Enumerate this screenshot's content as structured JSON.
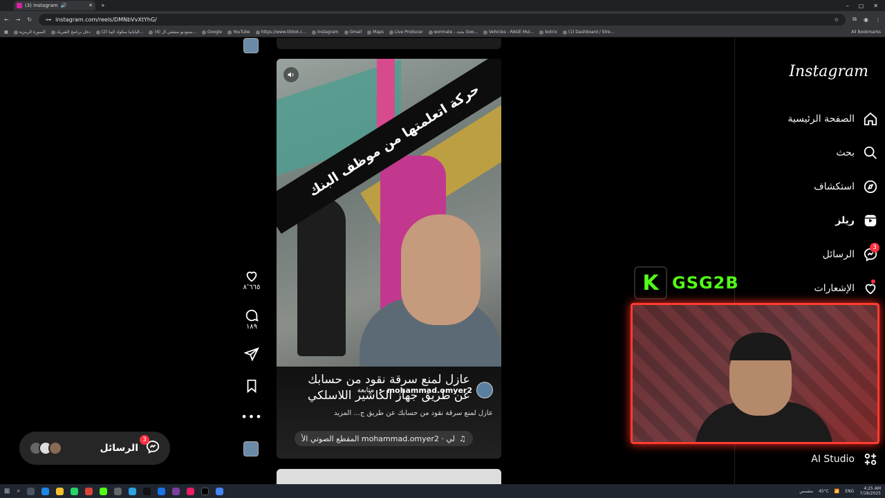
{
  "browser": {
    "tab_title": "(3) Instagram",
    "url": "instagram.com/reels/DMNbVvXtYhG/",
    "bookmarks": [
      "الصورة الرمزية",
      "دخل برنامج الشريك",
      "(2) اليابانيا سكواد اليبا...",
      "(4) ستوديو منشئي ال...",
      "Google",
      "YouTube",
      "https://www.tiktok.c...",
      "Instagram",
      "Gmail",
      "Maps",
      "Live Producer",
      "wormate - بحث Goo...",
      "Vehicles - RAGE Mul...",
      "botrix",
      "(1) Dashboard / Stre..."
    ],
    "all_bookmarks": "All Bookmarks"
  },
  "sidebar": {
    "logo": "Instagram",
    "items": [
      {
        "label": "الصفحة الرئيسية",
        "icon": "home-icon"
      },
      {
        "label": "بحث",
        "icon": "search-icon"
      },
      {
        "label": "استكشاف",
        "icon": "compass-icon"
      },
      {
        "label": "ريلز",
        "icon": "reels-icon"
      },
      {
        "label": "الرسائل",
        "icon": "messenger-icon",
        "badge": "3"
      },
      {
        "label": "الإشعارات",
        "icon": "heart-icon"
      }
    ],
    "ai_studio": "AI Studio"
  },
  "reel": {
    "banner_text": "حركة اتعلمتها من موظف البنك",
    "caption_big_line1": "عازل لمنع سرقة نقود من حسابك",
    "caption_big_line2": "عن طريق جهاز الكاشير اللاسلكي",
    "author": "mohammad.omyer2",
    "follow": "متابعة",
    "caption_small": "عازل لمنع سرقة نقود من حسابك عن طريق ج... المزيد",
    "audio": "لي · mohammad.omyer2 المقطع الصوتي الأ"
  },
  "actions": {
    "likes": "٨٬٦٦٥",
    "comments": "١٨٩"
  },
  "floating_messages": {
    "label": "الرسائل",
    "badge": "3"
  },
  "stream_overlay": {
    "channel_name": "GSG2B",
    "logo_letter": "K"
  },
  "taskbar": {
    "weather": "45°C",
    "weather_label": "مشمس",
    "lang": "ENG",
    "time": "4:25 AM",
    "date": "7/18/2025"
  }
}
